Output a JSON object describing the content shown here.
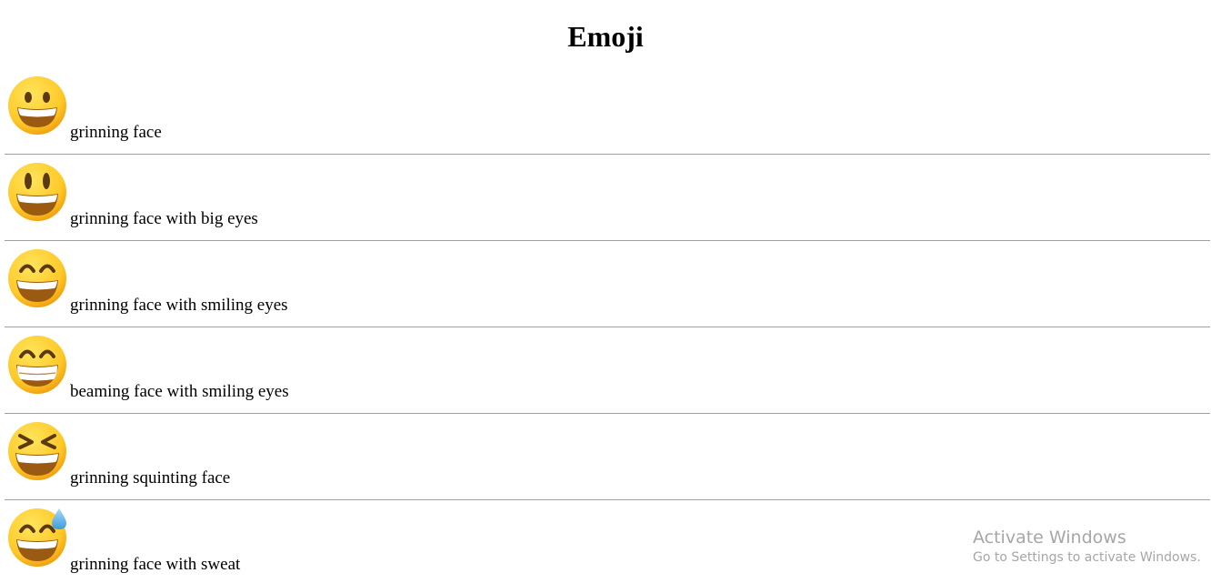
{
  "page": {
    "title": "Emoji"
  },
  "emojis": [
    {
      "label": "grinning face",
      "icon": "grinning-face-icon"
    },
    {
      "label": "grinning face with big eyes",
      "icon": "grinning-face-big-eyes-icon"
    },
    {
      "label": "grinning face with smiling eyes",
      "icon": "grinning-face-smiling-eyes-icon"
    },
    {
      "label": "beaming face with smiling eyes",
      "icon": "beaming-face-smiling-eyes-icon"
    },
    {
      "label": "grinning squinting face",
      "icon": "grinning-squinting-face-icon"
    },
    {
      "label": "grinning face with sweat",
      "icon": "grinning-face-with-sweat-icon"
    }
  ],
  "watermark": {
    "title": "Activate Windows",
    "subtitle": "Go to Settings to activate Windows."
  },
  "colors": {
    "face_light": "#FFD93B",
    "face_dark": "#F0A20A",
    "mouth": "#9A5A12",
    "teeth": "#FFFFFF",
    "eyes": "#5B3A12",
    "sweat": "#5FB4E8",
    "divider": "#A0A0A0",
    "watermark": "#A6A6A6"
  }
}
